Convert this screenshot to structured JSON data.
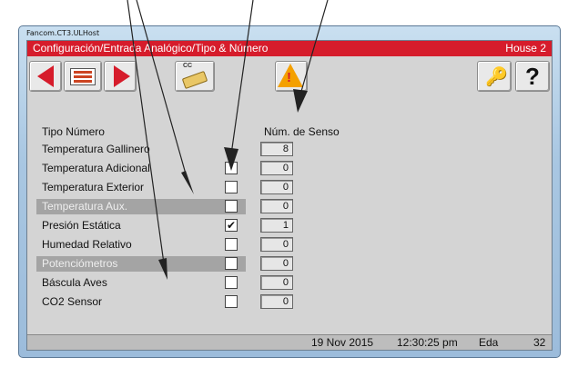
{
  "window": {
    "app_title": "Fancom.CT3.ULHost"
  },
  "header": {
    "path": "Configuración/Entrada Analógico/Tipo & Número",
    "house": "House 2"
  },
  "toolbar": {
    "cc_label": "CC",
    "warning_mark": "!",
    "help_label": "?"
  },
  "table": {
    "col_type_header": "Tipo Número",
    "col_sensor_header": "Núm. de Senso",
    "rows": [
      {
        "label": "Temperatura Gallinero",
        "checked": null,
        "value": "8",
        "shaded": false
      },
      {
        "label": "Temperatura Adicional",
        "checked": false,
        "value": "0",
        "shaded": false
      },
      {
        "label": "Temperatura Exterior",
        "checked": false,
        "value": "0",
        "shaded": false
      },
      {
        "label": "Temperatura Aux.",
        "checked": false,
        "value": "0",
        "shaded": true
      },
      {
        "label": "Presión Estática",
        "checked": true,
        "value": "1",
        "shaded": false
      },
      {
        "label": "Humedad Relativo",
        "checked": false,
        "value": "0",
        "shaded": false
      },
      {
        "label": "Potenciómetros",
        "checked": false,
        "value": "0",
        "shaded": true
      },
      {
        "label": "Báscula Aves",
        "checked": false,
        "value": "0",
        "shaded": false
      },
      {
        "label": "CO2 Sensor",
        "checked": false,
        "value": "0",
        "shaded": false
      }
    ]
  },
  "status": {
    "date": "19 Nov 2015",
    "time": "12:30:25 pm",
    "age_label": "Eda",
    "age_value": "32"
  },
  "colors": {
    "title_red": "#d61c2b",
    "client_gray": "#d4d4d4",
    "shaded_row": "#a4a4a4",
    "warning_yellow": "#f4a000"
  }
}
